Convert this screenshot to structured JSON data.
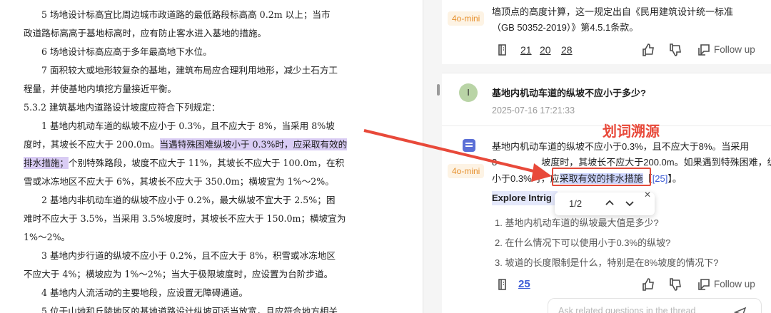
{
  "document": {
    "lines": [
      "5 场地设计标高宜比周边城市政道路的最低路段标高高 0.2m 以上；当市",
      "政道路标高高于基地标高时，应有防止客水进入基地的措施。",
      "6 场地设计标高应高于多年最高地下水位。",
      "7 面积较大或地形较复杂的基地，建筑布局应合理利用地形，减少土石方工",
      "程量，并使基地内填挖方量接近平衡。",
      "5.3.2 建筑基地内道路设计坡度应符合下列规定：",
      "1 基地内机动车道的纵坡不应小于 0.3%，且不应大于 8%，当采用 8%坡",
      "度时，其坡长不应大于 200.0m。",
      "当遇特殊困难纵坡小于 0.3%时，应采取有效的",
      "排水措施；",
      "个别特殊路段，坡度不应大于 11%，其坡长不应大于 100.0m，在积",
      "雪或冰冻地区不应大于 6%，其坡长不应大于 350.0m；横坡宜为 1%～2%。",
      "2 基地内非机动车道的纵坡不应小于 0.2%，最大纵坡不宜大于 2.5%；困",
      "难时不应大于 3.5%，当采用 3.5%坡度时，其坡长不应大于 150.0m；横坡宜为",
      "1%～2%。",
      "3 基地内步行道的纵坡不应小于 0.2%，且不应大于 8%，积雪或冰冻地区",
      "不应大于 4%；横坡应为 1%～2%；当大于极限坡度时，应设置为台阶步道。",
      "4 基地内人流活动的主要地段，应设置无障碍通道。",
      "5 位于山地和丘陵地区的基地道路设计纵坡可适当放宽，且应符合地方相关"
    ]
  },
  "chat": {
    "prev_answer": {
      "model": "4o-mini",
      "line1": "墙顶点的高度计算，这一规定出自《民用建筑设计统一标准",
      "line2": "（GB 50352-2019）》第4.5.1条款。",
      "refs": [
        "21",
        "20",
        "28"
      ],
      "follow_up": "Follow up"
    },
    "question": {
      "avatar_letter": "I",
      "text": "基地内机动车道的纵坡不应小于多少?",
      "timestamp": "2025-07-16 17:21:33"
    },
    "answer": {
      "model": "4o-mini",
      "line1": "基地内机动车道的纵坡不应小于0.3%，且不应大于8%。当采用",
      "line2_a": "8",
      "line2_b": "坡度时，其坡长不应大于200.0m。如果遇到特殊困难，纵坡",
      "line3_a": "小于0.3%时，",
      "line3_b": "应",
      "line3_hl": "采取有效的排水措施",
      "line3_c": "【",
      "line3_ref": "[25]",
      "line3_d": "】。",
      "annotation": "划词溯源",
      "pager": "1/2",
      "explore_title": "Explore Intrig",
      "questions": [
        "1. 基地内机动车道的纵坡最大值是多少?",
        "2. 在什么情况下可以使用小于0.3%的纵坡?",
        "3. 坡道的长度限制是什么，特别是在8%坡度的情况下?"
      ],
      "ref": "25",
      "follow_up": "Follow up"
    },
    "input_placeholder": "Ask related questions in the thread"
  },
  "colors": {
    "accent_red": "#e8493a",
    "highlight_doc": "#d9ccf4",
    "highlight_chat": "#cdd6ff",
    "link": "#3c5bd6",
    "model_tag": "#e6902e"
  }
}
